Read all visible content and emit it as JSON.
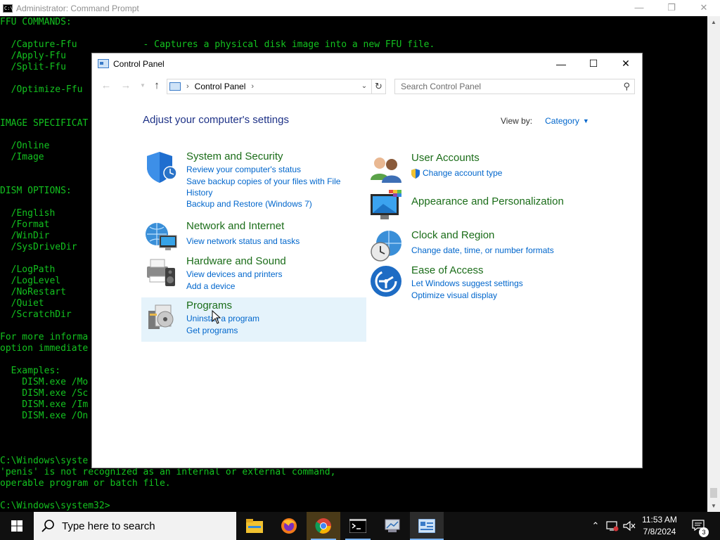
{
  "cmd": {
    "title": "Administrator: Command Prompt",
    "icon": "cmd-icon",
    "lines": [
      "FFU COMMANDS:",
      "",
      "  /Capture-Ffu            - Captures a physical disk image into a new FFU file.",
      "  /Apply-Ffu",
      "  /Split-Ffu",
      "",
      "  /Optimize-Ffu",
      "",
      "",
      "IMAGE SPECIFICAT",
      "",
      "  /Online",
      "  /Image",
      "",
      "",
      "DISM OPTIONS:",
      "",
      "  /English",
      "  /Format",
      "  /WinDir",
      "  /SysDriveDir",
      "",
      "  /LogPath",
      "  /LogLevel",
      "  /NoRestart",
      "  /Quiet",
      "  /ScratchDir",
      "",
      "For more informa",
      "option immediate",
      "",
      "  Examples:",
      "    DISM.exe /Mo",
      "    DISM.exe /Sc",
      "    DISM.exe /Im",
      "    DISM.exe /On",
      "",
      "",
      "",
      "C:\\Windows\\syste",
      "'penis' is not recognized as an internal or external command,",
      "operable program or batch file.",
      "",
      "C:\\Windows\\system32>"
    ],
    "text_color": "#13c21f"
  },
  "control_panel": {
    "title": "Control Panel",
    "address": {
      "crumb": "Control Panel"
    },
    "search": {
      "placeholder": "Search Control Panel"
    },
    "heading": "Adjust your computer's settings",
    "view_by": {
      "label": "View by:",
      "value": "Category"
    },
    "categories": [
      {
        "title": "System and Security",
        "icon": "shield-icon",
        "links": [
          "Review your computer's status",
          "Save backup copies of your files with File",
          "History",
          "Backup and Restore (Windows 7)"
        ]
      },
      {
        "title": "Network and Internet",
        "icon": "network-globe-icon",
        "links": [
          "View network status and tasks"
        ]
      },
      {
        "title": "Hardware and Sound",
        "icon": "printer-speaker-icon",
        "links": [
          "View devices and printers",
          "Add a device"
        ]
      },
      {
        "title": "Programs",
        "icon": "programs-disc-icon",
        "links": [
          "Uninstall a program",
          "Get programs"
        ]
      },
      {
        "title": "User Accounts",
        "icon": "users-icon",
        "links": [
          "Change account type"
        ]
      },
      {
        "title": "Appearance and Personalization",
        "icon": "monitor-palette-icon",
        "links": []
      },
      {
        "title": "Clock and Region",
        "icon": "clock-globe-icon",
        "links": [
          "Change date, time, or number formats"
        ]
      },
      {
        "title": "Ease of Access",
        "icon": "ease-of-access-icon",
        "links": [
          "Let Windows suggest settings",
          "Optimize visual display"
        ]
      }
    ]
  },
  "taskbar": {
    "search_text": "Type here to search",
    "apps": [
      "file-explorer-icon",
      "firefox-icon",
      "chrome-icon",
      "cmd-icon",
      "system-tool-icon",
      "control-panel-icon"
    ],
    "clock": {
      "time": "11:53 AM",
      "date": "7/8/2024"
    },
    "notifications_count": "3"
  }
}
